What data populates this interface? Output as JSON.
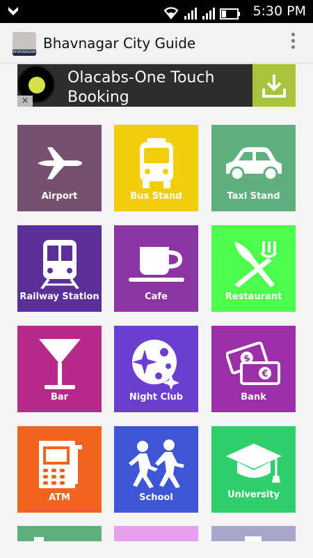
{
  "status_bar": {
    "time": "5:30 PM"
  },
  "app_bar": {
    "title": "Bhavnagar City Guide",
    "logo_text": "BHAVNAGAR"
  },
  "ad": {
    "text": "Olacabs-One Touch Booking",
    "close": "×"
  },
  "tiles": [
    {
      "label": "Airport",
      "color": "#76516f",
      "icon": "airplane-icon"
    },
    {
      "label": "Bus Stand",
      "color": "#f2cd0b",
      "icon": "bus-icon"
    },
    {
      "label": "Taxi Stand",
      "color": "#5eb07f",
      "icon": "taxi-icon"
    },
    {
      "label": "Railway Station",
      "color": "#5a2f97",
      "icon": "train-icon"
    },
    {
      "label": "Cafe",
      "color": "#8b35a4",
      "icon": "coffee-cup-icon"
    },
    {
      "label": "Restaurant",
      "color": "#4cff4c",
      "icon": "fork-knife-icon"
    },
    {
      "label": "Bar",
      "color": "#b82a8a",
      "icon": "cocktail-glass-icon"
    },
    {
      "label": "Night Club",
      "color": "#6a3fcf",
      "icon": "moon-stars-icon"
    },
    {
      "label": "Bank",
      "color": "#9a2fa8",
      "icon": "money-icon"
    },
    {
      "label": "ATM",
      "color": "#f0641e",
      "icon": "atm-icon"
    },
    {
      "label": "School",
      "color": "#3c56d6",
      "icon": "children-running-icon"
    },
    {
      "label": "University",
      "color": "#2fcf6b",
      "icon": "graduation-cap-icon"
    },
    {
      "label": "",
      "color": "#5eb07f",
      "icon": ""
    },
    {
      "label": "",
      "color": "#e7a0ee",
      "icon": ""
    },
    {
      "label": "",
      "color": "#a7a8c9",
      "icon": ""
    }
  ]
}
